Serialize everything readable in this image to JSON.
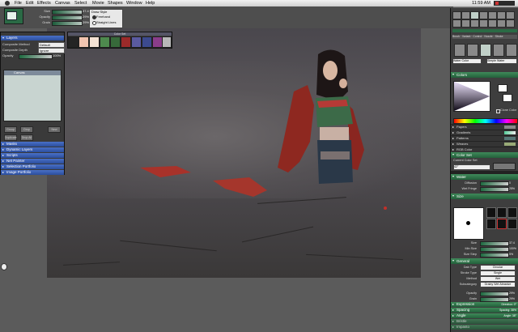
{
  "menubar": {
    "items": [
      "File",
      "Edit",
      "Effects",
      "Canvas",
      "Select",
      "Movie",
      "Shapes",
      "Window",
      "Help"
    ],
    "clock": "11:59 AM"
  },
  "tool_options": {
    "rows": [
      {
        "label": "Size",
        "value": "37.4"
      },
      {
        "label": "Opacity",
        "value": "29%"
      },
      {
        "label": "Grain",
        "value": "29%"
      }
    ],
    "draw_style": {
      "title": "Draw Style",
      "options": [
        "Freehand",
        "Straight Lines"
      ],
      "selected": "Freehand"
    }
  },
  "layers_palette": {
    "title": "Layers",
    "composite_method": {
      "label": "Composite Method",
      "value": "Default"
    },
    "composite_depth": {
      "label": "Composite Depth",
      "value": "Ignore"
    },
    "opacity": {
      "label": "Opacity",
      "value": "100%"
    },
    "layer_header": "Canvas",
    "buttons": [
      "Group",
      "Drop",
      "New",
      "Duplicate",
      "Drop All"
    ],
    "sections": [
      "Masks",
      "Dynamic Layers",
      "Scripts",
      "Net Painter",
      "Selection Portfolio",
      "Image Portfolio"
    ]
  },
  "color_set": {
    "title": "Color Set",
    "chips": [
      "#f1c4b0",
      "#f4e2d4",
      "#4e8a4e",
      "#37693a",
      "#9b2a2a",
      "#5a5aa0",
      "#3c4a8e",
      "#8a3d8a",
      "#242424",
      "#b8b8b8"
    ]
  },
  "brush_tools": {
    "category": "Water Color",
    "variant": "Simple Water"
  },
  "art_palette": {
    "colors_title": "Colors",
    "clone_color": "Clone Color",
    "sections": [
      "Papers",
      "Gradients",
      "Patterns",
      "Weaves",
      "RGB Color"
    ],
    "color_set_title": "Color Set",
    "current_color_set_label": "Current Color Set",
    "current_color_set_value": "42°"
  },
  "brush_controls": {
    "water": {
      "title": "Water",
      "rows": [
        {
          "label": "Diffusion",
          "value": "0"
        },
        {
          "label": "Wet Fringe",
          "value": "25%"
        }
      ]
    },
    "size": {
      "title": "Size",
      "rows": [
        {
          "label": "Size",
          "value": "37.4"
        },
        {
          "label": "Min Size",
          "value": "100%"
        },
        {
          "label": "Size Step",
          "value": "5%"
        }
      ]
    },
    "general": {
      "title": "General",
      "rows": [
        {
          "label": "Dab Type",
          "value": "Circular"
        },
        {
          "label": "Stroke Type",
          "value": "Single"
        },
        {
          "label": "Method",
          "value": "Wet"
        },
        {
          "label": "Subcategory",
          "value": "Grainy Wet Abrasive"
        }
      ],
      "sliders": [
        {
          "label": "Opacity",
          "value": "29%"
        },
        {
          "label": "Grain",
          "value": "29%"
        }
      ]
    },
    "sections": [
      "Expression",
      "Spacing",
      "Angle",
      "Bristle",
      "Impasto"
    ],
    "section_values": [
      "Direction: 0°",
      "Spacing: 38%",
      "Angle: 38°",
      "",
      ""
    ]
  }
}
